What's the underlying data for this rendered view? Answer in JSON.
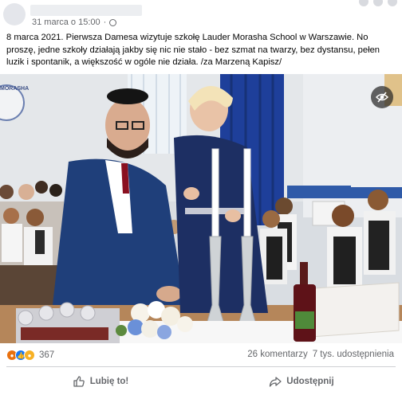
{
  "post": {
    "timestamp": "31 marca o 15:00",
    "text": "8 marca 2021. Pierwsza Damesa wizytuje szkołę Lauder Morasha School w Warszawie. No proszę, jedne szkoły działają jakby się nic nie stało - bez szmat na twarzy, bez dystansu, pełen luzik i spontanik, a większość w ogóle nie działa. /za Marzeną Kapisz/",
    "photo_banner_text": "MORASHA"
  },
  "stats": {
    "reaction_icons": [
      "angry-icon",
      "like-icon",
      "wow-icon"
    ],
    "reaction_count": "367",
    "comments": "26 komentarzy",
    "shares": "7 tys. udostępnienia"
  },
  "actions": {
    "like_label": "Lubię to!",
    "share_label": "Udostępnij"
  },
  "colors": {
    "accent": "#1877f2",
    "meta_text": "#65676b",
    "curtain_blue": "#1e3f9a"
  }
}
